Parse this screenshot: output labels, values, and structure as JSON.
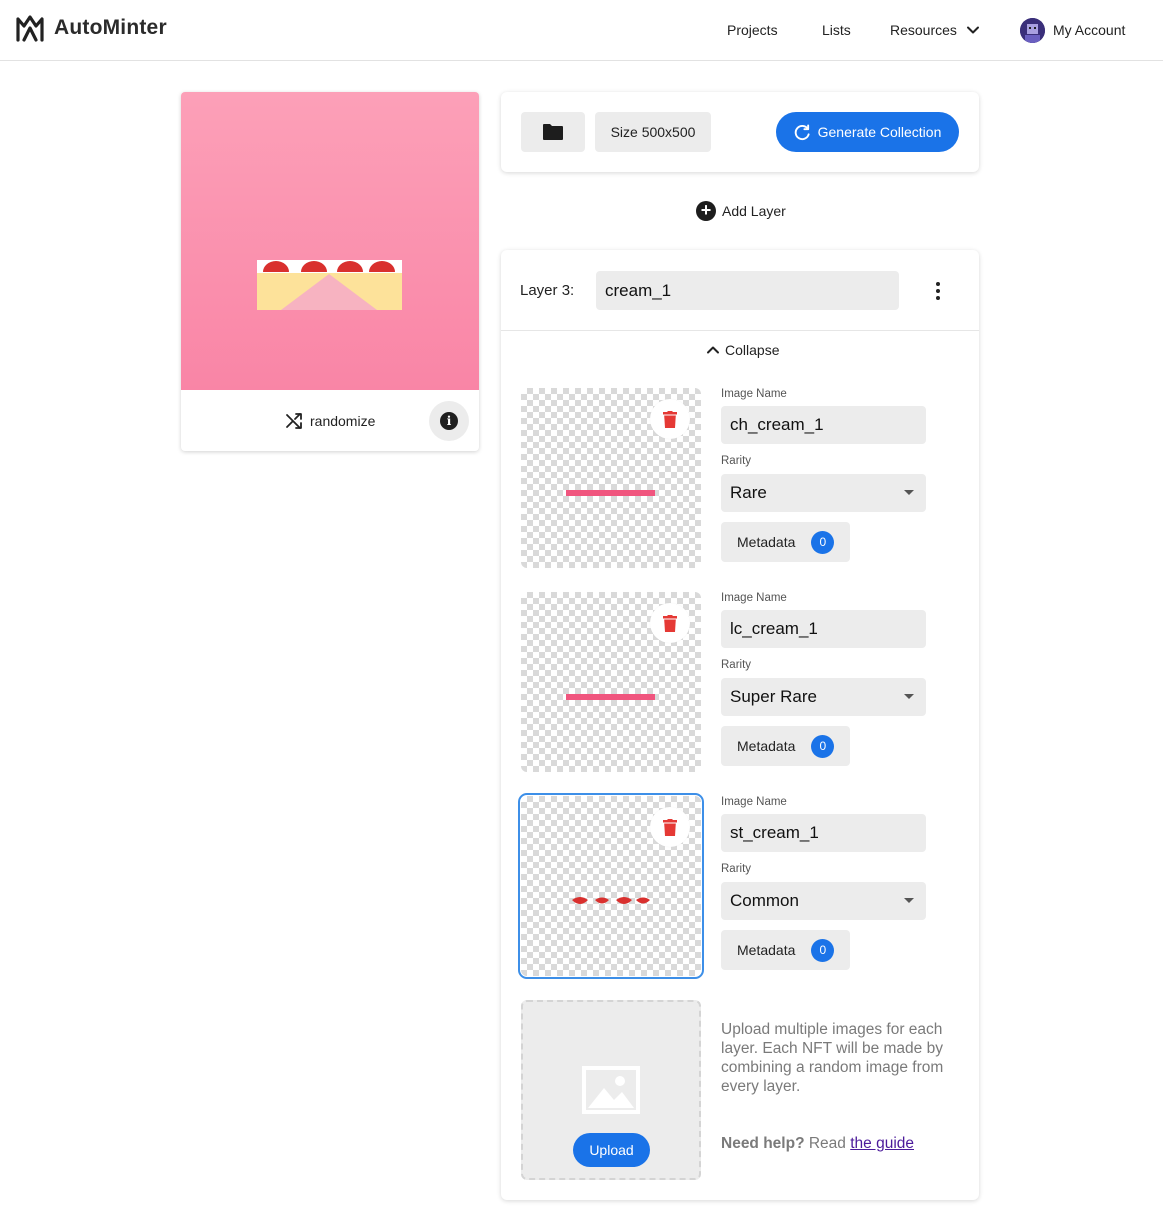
{
  "header": {
    "brand": "AutoMinter",
    "nav": {
      "projects": "Projects",
      "lists": "Lists",
      "resources": "Resources",
      "account": "My Account"
    }
  },
  "preview": {
    "randomize_label": "randomize",
    "info_glyph": "i"
  },
  "toolbar": {
    "size_label": "Size 500x500",
    "generate_label": "Generate Collection"
  },
  "add_layer_label": "Add Layer",
  "layer": {
    "label": "Layer 3:",
    "name": "cream_1",
    "collapse_label": "Collapse",
    "images": [
      {
        "image_name_label": "Image Name",
        "name": "ch_cream_1",
        "rarity_label": "Rarity",
        "rarity": "Rare",
        "metadata_label": "Metadata",
        "metadata_count": "0"
      },
      {
        "image_name_label": "Image Name",
        "name": "lc_cream_1",
        "rarity_label": "Rarity",
        "rarity": "Super Rare",
        "metadata_label": "Metadata",
        "metadata_count": "0"
      },
      {
        "image_name_label": "Image Name",
        "name": "st_cream_1",
        "rarity_label": "Rarity",
        "rarity": "Common",
        "metadata_label": "Metadata",
        "metadata_count": "0"
      }
    ],
    "upload": {
      "button_label": "Upload",
      "description": "Upload multiple images for each layer. Each NFT will be made by combining a random image from every layer.",
      "help_prefix": "Need help?",
      "help_middle": " Read ",
      "help_link": "the guide"
    }
  },
  "colors": {
    "accent": "#1a73e8",
    "delete_icon": "#e53935",
    "preview_bg": "#fa90ae",
    "cream_stripe": "#f0557e",
    "strawberry": "#d9302e"
  },
  "icons": {
    "logo": "autominter-logo-icon",
    "resources_caret": "chevron-down-icon",
    "folder": "folder-icon",
    "generate": "refresh-icon",
    "add_layer": "plus-circle-icon",
    "more": "more-vertical-icon",
    "collapse": "chevron-up-icon",
    "delete": "trash-icon",
    "randomize": "shuffle-icon",
    "info": "info-icon",
    "upload_placeholder": "image-icon"
  }
}
